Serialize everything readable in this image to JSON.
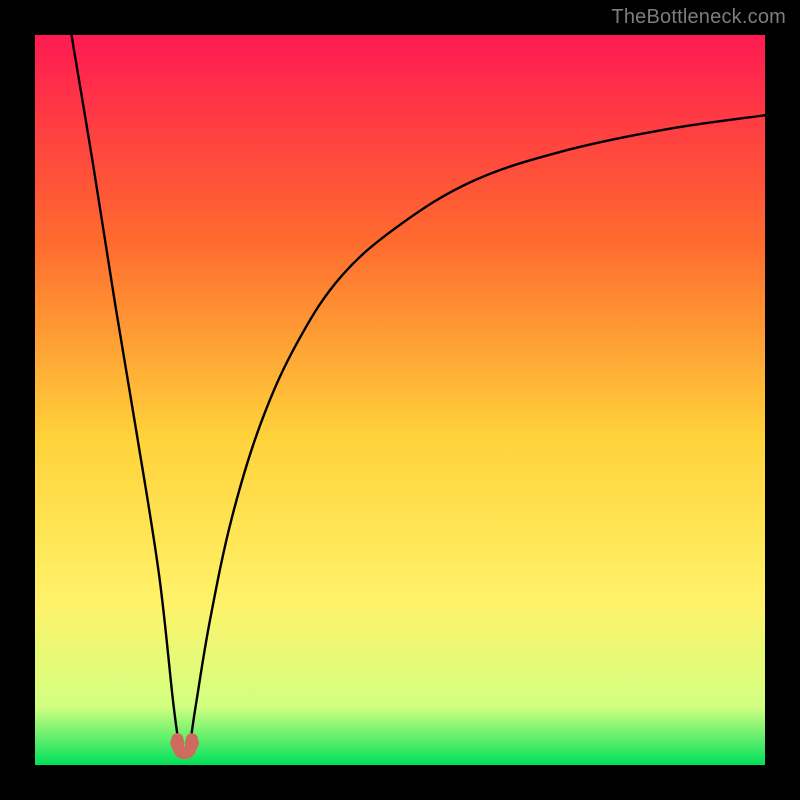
{
  "watermark": "TheBottleneck.com",
  "colors": {
    "frame": "#000000",
    "gradient_top": "#ff1a52",
    "gradient_mid1": "#ff6a2f",
    "gradient_mid2": "#ffd23a",
    "gradient_mid3": "#fff36a",
    "gradient_low": "#d2ff81",
    "gradient_bottom": "#00e05a",
    "curve": "#000000",
    "marker_fill": "#cf6a5e",
    "marker_stroke": "#cf6a5e"
  },
  "chart_data": {
    "type": "line",
    "title": "",
    "xlabel": "",
    "ylabel": "",
    "xlim": [
      0,
      100
    ],
    "ylim": [
      0,
      100
    ],
    "notes": "Bottleneck-percentage curve; V-shaped dip near x≈20 reaching ~0, rising toward ~100 on both sides (left faster than right). Background gradient green→red encodes low→high bottleneck.",
    "series": [
      {
        "name": "bottleneck-curve",
        "x": [
          5,
          8,
          11,
          14,
          17,
          19,
          20,
          21,
          22,
          24,
          27,
          31,
          36,
          42,
          50,
          60,
          72,
          86,
          100
        ],
        "y": [
          100,
          82,
          63,
          45,
          26,
          8,
          2,
          2,
          8,
          20,
          34,
          47,
          58,
          67,
          74,
          80,
          84,
          87,
          89
        ]
      }
    ],
    "markers": [
      {
        "name": "min-marker-left",
        "x": 19.5,
        "y": 3
      },
      {
        "name": "min-marker-right",
        "x": 21.5,
        "y": 3
      }
    ]
  }
}
